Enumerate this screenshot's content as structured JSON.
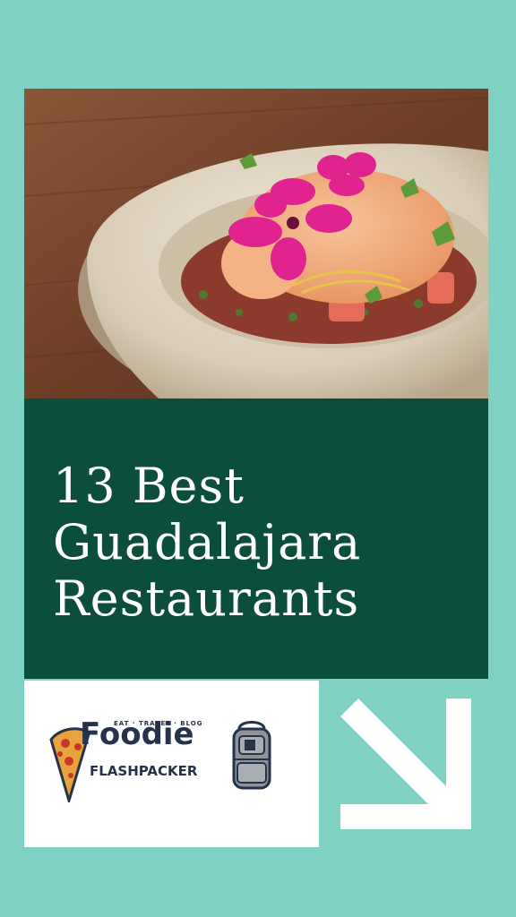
{
  "hero": {
    "image_alt": "Plated dish in a stone bowl topped with pink flowers"
  },
  "headline": {
    "lines": [
      "13 Best",
      "Guadalajara",
      "Restaurants"
    ]
  },
  "brand": {
    "tagline": "EAT · TRAVEL · BLOG",
    "name_top": "Foodie",
    "name_bottom": "FLASHPACKER"
  },
  "cta": {
    "icon": "arrow-down-right-icon"
  },
  "colors": {
    "background": "#7fd1c4",
    "title_panel": "#0b4e3b",
    "title_text": "#ffffff",
    "logo_text": "#25324a"
  }
}
